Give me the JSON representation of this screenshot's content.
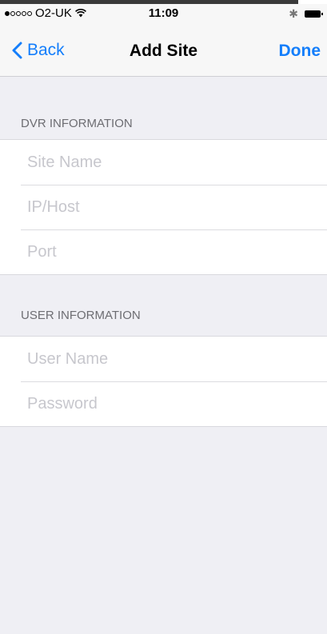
{
  "status_bar": {
    "carrier": "O2-UK",
    "time": "11:09",
    "wifi_icon": "wifi-icon",
    "bluetooth_icon": "bluetooth-icon",
    "battery_icon": "battery-icon"
  },
  "nav": {
    "back_label": "Back",
    "title": "Add Site",
    "done_label": "Done",
    "accent_color": "#147efb"
  },
  "dvr_section": {
    "header": "DVR INFORMATION",
    "fields": [
      {
        "placeholder": "Site Name",
        "value": ""
      },
      {
        "placeholder": "IP/Host",
        "value": ""
      },
      {
        "placeholder": "Port",
        "value": ""
      }
    ]
  },
  "user_section": {
    "header": "USER INFORMATION",
    "fields": [
      {
        "placeholder": "User Name",
        "value": ""
      },
      {
        "placeholder": "Password",
        "value": ""
      }
    ]
  }
}
